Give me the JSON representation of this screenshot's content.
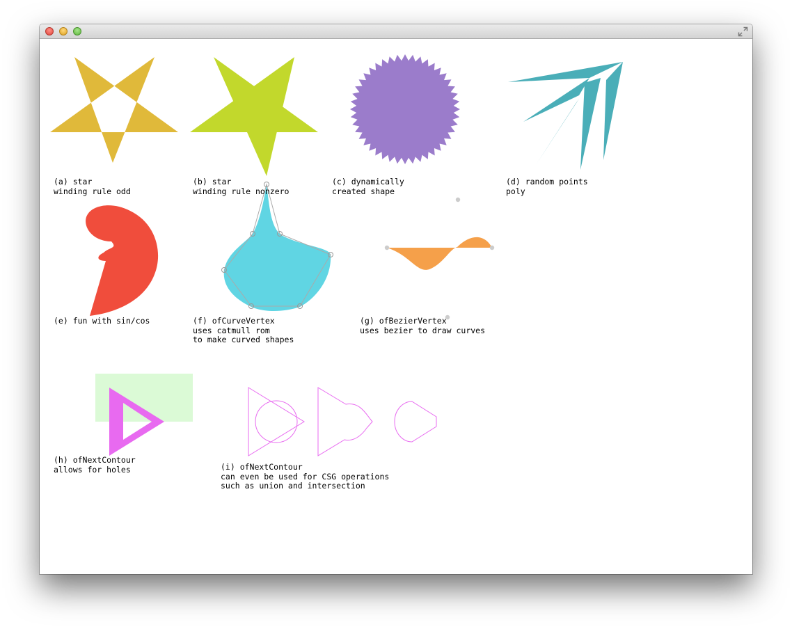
{
  "window": {
    "buttons": [
      "close",
      "minimize",
      "zoom"
    ],
    "fullscreen_icon": "fullscreen-arrows-icon"
  },
  "colors": {
    "star_odd": "#e0b93a",
    "star_nonzero": "#c2d82c",
    "dynamic_shape": "#9b7ccb",
    "random_poly": "#4aaeb8",
    "sincos": "#f04d3c",
    "curve": "#60d5e3",
    "bezier": "#f5a04a",
    "holes": "#e86af0",
    "holes_rect": "#dbfad6",
    "csg": "#e86af0"
  },
  "captions": {
    "a": "(a) star\nwinding rule odd",
    "b": "(b) star\nwinding rule nonzero",
    "c": "(c) dynamically\ncreated shape",
    "d": "(d) random points\npoly",
    "e": "(e) fun with sin/cos",
    "f": "(f) ofCurveVertex\nuses catmull rom\nto make curved shapes",
    "g": "(g) ofBezierVertex\nuses bezier to draw curves",
    "h": "(h) ofNextContour\nallows for holes",
    "i": "(i) ofNextContour\ncan even be used for CSG operations\nsuch as union and intersection"
  }
}
